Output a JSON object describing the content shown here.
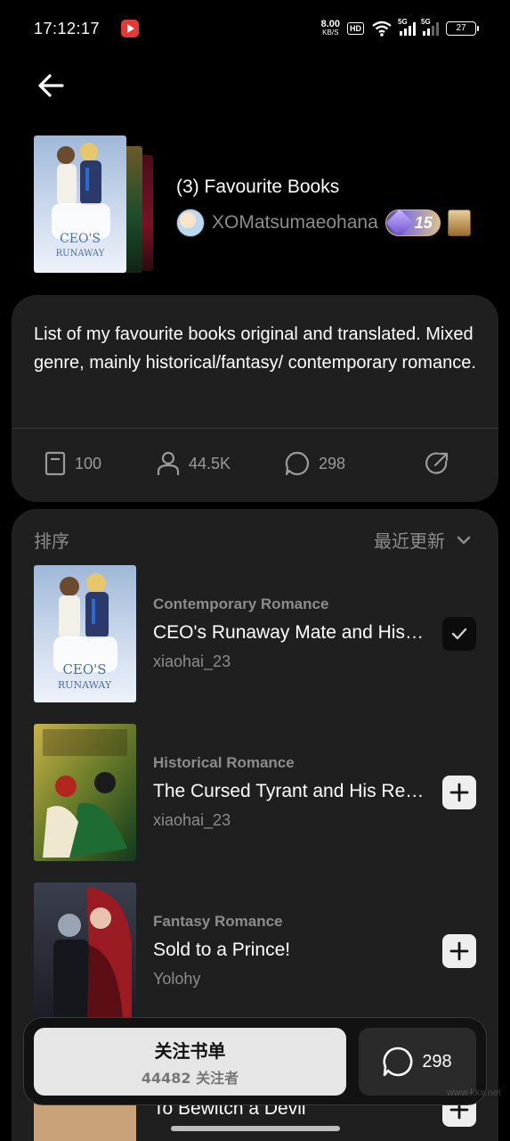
{
  "status_bar": {
    "time": "17:12:17",
    "net_speed_value": "8.00",
    "net_speed_unit": "KB/S",
    "hd_label": "HD",
    "sim1_label": "5G",
    "sim2_label": "5G",
    "battery": "27"
  },
  "header": {
    "title": "(3) Favourite Books",
    "author_name": "XOMatsumaeohana",
    "level": "15"
  },
  "description": {
    "text": "List of my favourite books original and translated. Mixed genre, mainly historical/fantasy/ contemporary romance."
  },
  "stats": {
    "books": "100",
    "followers": "44.5K",
    "comments": "298"
  },
  "books_section": {
    "sort_label": "排序",
    "sort_value": "最近更新",
    "items": [
      {
        "genre": "Contemporary Romance",
        "title": "CEO's Runaway Mate and His Cubs",
        "author": "xiaohai_23",
        "action": "checked"
      },
      {
        "genre": "Historical Romance",
        "title": "The Cursed Tyrant and His Reluctant Queen",
        "author": "xiaohai_23",
        "action": "add"
      },
      {
        "genre": "Fantasy Romance",
        "title": "Sold to a Prince!",
        "author": "Yolohy",
        "action": "add"
      },
      {
        "genre": "",
        "title": "To Bewitch a Devil",
        "author": "",
        "action": "add"
      }
    ]
  },
  "bottom_bar": {
    "follow_label": "关注书单",
    "follow_count": "44482 关注者",
    "comment_count": "298"
  },
  "watermark": {
    "text": "www.kkx.net"
  },
  "colors": {
    "background": "#000000",
    "card": "#1f1f1f",
    "muted_text": "#8c8c8c",
    "follow_button": "#e6e6e6"
  }
}
